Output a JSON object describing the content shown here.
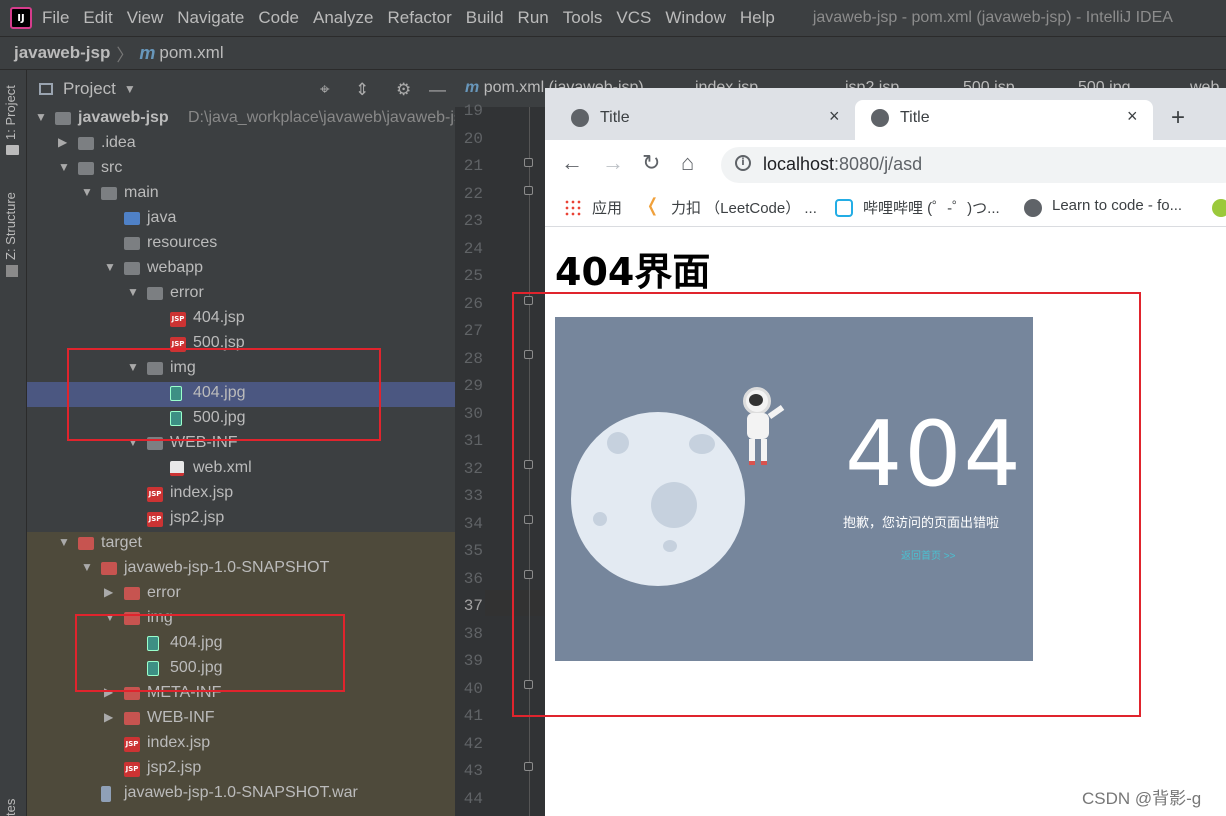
{
  "menu": {
    "items": [
      "File",
      "Edit",
      "View",
      "Navigate",
      "Code",
      "Analyze",
      "Refactor",
      "Build",
      "Run",
      "Tools",
      "VCS",
      "Window",
      "Help"
    ],
    "window_title": "javaweb-jsp - pom.xml (javaweb-jsp) - IntelliJ IDEA"
  },
  "breadcrumb": {
    "project": "javaweb-jsp",
    "file": "pom.xml",
    "separator": "〉"
  },
  "side_tabs": {
    "project": "1: Project",
    "structure": "Z: Structure",
    "bottom": "tes"
  },
  "project_panel": {
    "title": "Project",
    "dropdown_icon": "chevron-down-icon"
  },
  "tree": [
    {
      "label": "javaweb-jsp",
      "path": "D:\\java_workplace\\javaweb\\javaweb-js",
      "arrow": "▼",
      "icon": "module"
    },
    {
      "label": ".idea",
      "arrow": "▶",
      "icon": "folder"
    },
    {
      "label": "src",
      "arrow": "▼",
      "icon": "folder"
    },
    {
      "label": "main",
      "arrow": "▼",
      "icon": "folder"
    },
    {
      "label": "java",
      "arrow": "",
      "icon": "folder-blue"
    },
    {
      "label": "resources",
      "arrow": "",
      "icon": "folder"
    },
    {
      "label": "webapp",
      "arrow": "▼",
      "icon": "folder"
    },
    {
      "label": "error",
      "arrow": "▼",
      "icon": "folder"
    },
    {
      "label": "404.jsp",
      "arrow": "",
      "icon": "jsp"
    },
    {
      "label": "500.jsp",
      "arrow": "",
      "icon": "jsp"
    },
    {
      "label": "img",
      "arrow": "▼",
      "icon": "folder"
    },
    {
      "label": "404.jpg",
      "arrow": "",
      "icon": "image"
    },
    {
      "label": "500.jpg",
      "arrow": "",
      "icon": "image"
    },
    {
      "label": "WEB-INF",
      "arrow": "▼",
      "icon": "folder"
    },
    {
      "label": "web.xml",
      "arrow": "",
      "icon": "xml"
    },
    {
      "label": "index.jsp",
      "arrow": "",
      "icon": "jsp"
    },
    {
      "label": "jsp2.jsp",
      "arrow": "",
      "icon": "jsp"
    },
    {
      "label": "target",
      "arrow": "▼",
      "icon": "folder-red"
    },
    {
      "label": "javaweb-jsp-1.0-SNAPSHOT",
      "arrow": "▼",
      "icon": "folder-red"
    },
    {
      "label": "error",
      "arrow": "▶",
      "icon": "folder-red"
    },
    {
      "label": "img",
      "arrow": "▼",
      "icon": "folder-red"
    },
    {
      "label": "404.jpg",
      "arrow": "",
      "icon": "image"
    },
    {
      "label": "500.jpg",
      "arrow": "",
      "icon": "image"
    },
    {
      "label": "META-INF",
      "arrow": "▶",
      "icon": "folder-red"
    },
    {
      "label": "WEB-INF",
      "arrow": "▶",
      "icon": "folder-red"
    },
    {
      "label": "index.jsp",
      "arrow": "",
      "icon": "jsp"
    },
    {
      "label": "jsp2.jsp",
      "arrow": "",
      "icon": "jsp"
    },
    {
      "label": "javaweb-jsp-1.0-SNAPSHOT.war",
      "arrow": "",
      "icon": "war"
    }
  ],
  "editor_tabs": [
    "pom.xml (javaweb-jsp)",
    "index.jsp",
    "jsp2.jsp",
    "500.jsp",
    "500.jpg",
    "web"
  ],
  "line_numbers": [
    "19",
    "20",
    "21",
    "22",
    "23",
    "24",
    "25",
    "26",
    "27",
    "28",
    "29",
    "30",
    "31",
    "32",
    "33",
    "34",
    "35",
    "36",
    "37",
    "38",
    "39",
    "40",
    "41",
    "42",
    "43",
    "44"
  ],
  "current_line": "37",
  "browser": {
    "tabs": [
      {
        "title": "Title",
        "active": false
      },
      {
        "title": "Title",
        "active": true
      }
    ],
    "new_tab": "+",
    "close": "×",
    "url_host": "localhost",
    "url_rest": ":8080/j/asd",
    "bookmarks": [
      "应用",
      "力扣 （LeetCode） ...",
      "哔哩哔哩 (゜-゜)つ...",
      "Learn to code - fo..."
    ],
    "page_heading": "404界面",
    "image_big_text": "404",
    "image_message": "抱歉，您访问的页面出错啦",
    "image_link": "返回首页 >>"
  },
  "accent_colors": {
    "highlight_box": "#e0242d",
    "selection": "#4b5781"
  },
  "watermark": "CSDN @背影-g"
}
